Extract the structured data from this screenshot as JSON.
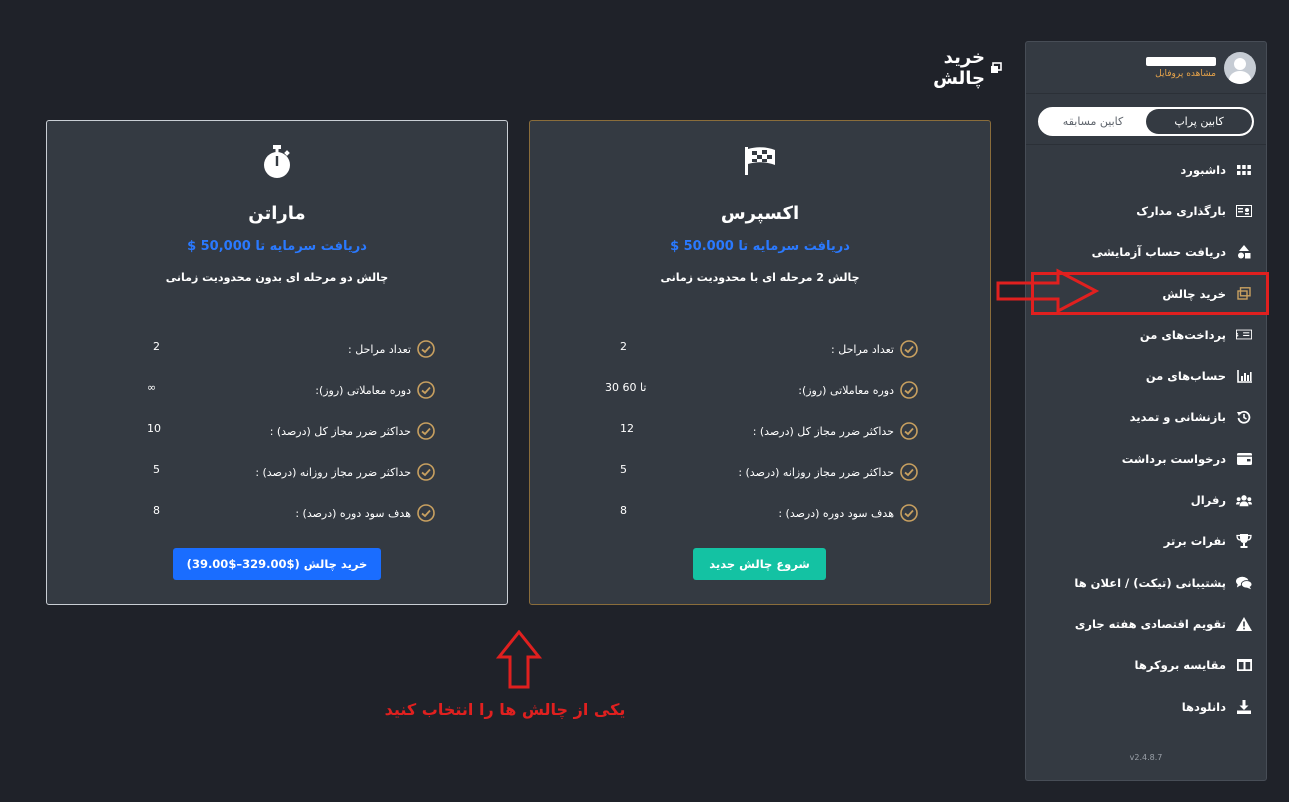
{
  "profile": {
    "view_profile": "مشاهده پروفایل"
  },
  "toggle": {
    "active": "کابین پراپ",
    "inactive": "کابین مسابقه"
  },
  "nav": {
    "items": [
      {
        "label": "داشبورد",
        "icon": "grid-icon"
      },
      {
        "label": "بارگذاری مدارک",
        "icon": "id-card-icon"
      },
      {
        "label": "دریافت حساب آزمایشی",
        "icon": "shapes-icon"
      },
      {
        "label": "خرید چالش",
        "icon": "window-icon"
      },
      {
        "label": "پرداخت‌های من",
        "icon": "money-bill-icon"
      },
      {
        "label": "حساب‌های من",
        "icon": "bar-chart-icon"
      },
      {
        "label": "بازنشانی و تمدید",
        "icon": "history-icon"
      },
      {
        "label": "درخواست برداشت",
        "icon": "wallet-icon"
      },
      {
        "label": "رفرال",
        "icon": "users-icon"
      },
      {
        "label": "نفرات برتر",
        "icon": "trophy-icon"
      },
      {
        "label": "پشتیبانی (تیکت) / اعلان ها",
        "icon": "comments-icon"
      },
      {
        "label": "تقویم اقتصادی هفته جاری",
        "icon": "warning-icon"
      },
      {
        "label": "مقایسه بروکرها",
        "icon": "columns-icon"
      },
      {
        "label": "دانلودها",
        "icon": "download-icon"
      }
    ],
    "active_index": 3
  },
  "version": "v2.4.8.7",
  "page": {
    "title": "خرید چالش"
  },
  "express": {
    "name": "اکسپرس",
    "funding": "دریافت سرمایه تا 50.000 $",
    "desc": "چالش 2 مرحله ای با محدودیت زمانی",
    "features": [
      {
        "label": "تعداد مراحل :",
        "value": "2"
      },
      {
        "label": "دوره معاملاتی (روز):",
        "value": "30 تا 60"
      },
      {
        "label": "حداکثر ضرر مجاز کل (درصد) :",
        "value": "12"
      },
      {
        "label": "حداکثر ضرر مجاز روزانه (درصد) :",
        "value": "5"
      },
      {
        "label": "هدف سود دوره (درصد) :",
        "value": "8"
      }
    ],
    "cta": "شروع چالش جدید"
  },
  "marathon": {
    "name": "ماراتن",
    "funding": "دریافت سرمایه تا 50,000 $",
    "desc": "چالش دو مرحله ای بدون محدودیت زمانی",
    "features": [
      {
        "label": "تعداد مراحل :",
        "value": "2"
      },
      {
        "label": "دوره معاملاتی (روز):",
        "value": "∞"
      },
      {
        "label": "حداکثر ضرر مجاز کل (درصد) :",
        "value": "10"
      },
      {
        "label": "حداکثر ضرر مجاز روزانه (درصد) :",
        "value": "5"
      },
      {
        "label": "هدف سود دوره (درصد) :",
        "value": "8"
      }
    ],
    "cta": "خرید چالش ($329.00–$39.00)"
  },
  "annotation": {
    "text": "یکی از چالش ها را انتخاب کنید"
  },
  "colors": {
    "accent_blue": "#1a6dff",
    "teal": "#14c2a3",
    "gold": "#c8a060",
    "highlight_red": "#e0201f"
  }
}
